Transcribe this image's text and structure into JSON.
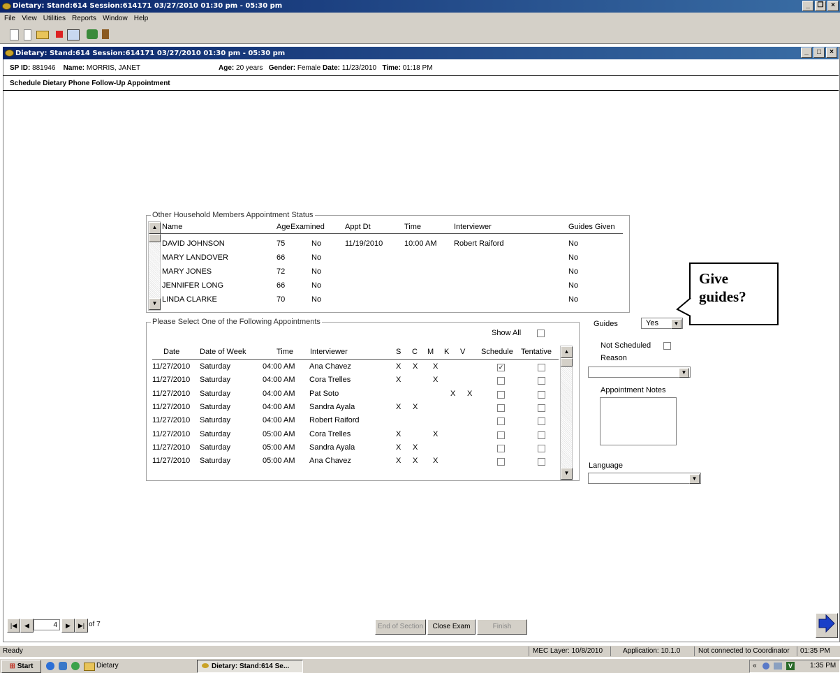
{
  "window": {
    "title": "Dietary: Stand:614 Session:614171 03/27/2010 01:30 pm - 05:30 pm"
  },
  "menu": [
    "File",
    "View",
    "Utilities",
    "Reports",
    "Window",
    "Help"
  ],
  "inner_window": {
    "title": "Dietary: Stand:614 Session:614171 03/27/2010 01:30 pm - 05:30 pm"
  },
  "participant": {
    "sp_id_label": "SP ID:",
    "sp_id": "881946",
    "name_label": "Name:",
    "name": "MORRIS, JANET",
    "age_label": "Age:",
    "age": "20 years",
    "gender_label": "Gender:",
    "gender": "Female",
    "date_label": "Date:",
    "date": "11/23/2010",
    "time_label": "Time:",
    "time": "01:18 PM"
  },
  "section_title": "Schedule Dietary Phone Follow-Up Appointment",
  "household": {
    "legend": "Other Household Members Appointment Status",
    "headers": [
      "Name",
      "Age",
      "Examined",
      "Appt Dt",
      "Time",
      "Interviewer",
      "Guides Given"
    ],
    "rows": [
      [
        "DAVID JOHNSON",
        "75",
        "No",
        "11/19/2010",
        "10:00 AM",
        "Robert Raiford",
        "No"
      ],
      [
        "MARY LANDOVER",
        "66",
        "No",
        "",
        "",
        "",
        "No"
      ],
      [
        "MARY JONES",
        "72",
        "No",
        "",
        "",
        "",
        "No"
      ],
      [
        "JENNIFER LONG",
        "66",
        "No",
        "",
        "",
        "",
        "No"
      ],
      [
        "LINDA CLARKE",
        "70",
        "No",
        "",
        "",
        "",
        "No"
      ]
    ]
  },
  "appointments": {
    "legend": "Please Select One of the Following Appointments",
    "show_all_label": "Show All",
    "headers": [
      "Date",
      "Date of Week",
      "Time",
      "Interviewer",
      "S",
      "C",
      "M",
      "K",
      "V",
      "Schedule",
      "Tentative"
    ],
    "rows": [
      {
        "date": "11/27/2010",
        "day": "Saturday",
        "time": "04:00 AM",
        "interviewer": "Ana Chavez",
        "s": "X",
        "c": "X",
        "m": "X",
        "k": "",
        "v": "",
        "schedule": true,
        "tentative": false
      },
      {
        "date": "11/27/2010",
        "day": "Saturday",
        "time": "04:00 AM",
        "interviewer": "Cora Trelles",
        "s": "X",
        "c": "",
        "m": "X",
        "k": "",
        "v": "",
        "schedule": false,
        "tentative": false
      },
      {
        "date": "11/27/2010",
        "day": "Saturday",
        "time": "04:00 AM",
        "interviewer": "Pat Soto",
        "s": "",
        "c": "",
        "m": "",
        "k": "X",
        "v": "X",
        "schedule": false,
        "tentative": false
      },
      {
        "date": "11/27/2010",
        "day": "Saturday",
        "time": "04:00 AM",
        "interviewer": "Sandra Ayala",
        "s": "X",
        "c": "X",
        "m": "",
        "k": "",
        "v": "",
        "schedule": false,
        "tentative": false
      },
      {
        "date": "11/27/2010",
        "day": "Saturday",
        "time": "04:00 AM",
        "interviewer": "Robert Raiford",
        "s": "",
        "c": "",
        "m": "",
        "k": "",
        "v": "",
        "schedule": false,
        "tentative": false
      },
      {
        "date": "11/27/2010",
        "day": "Saturday",
        "time": "05:00 AM",
        "interviewer": "Cora Trelles",
        "s": "X",
        "c": "",
        "m": "X",
        "k": "",
        "v": "",
        "schedule": false,
        "tentative": false
      },
      {
        "date": "11/27/2010",
        "day": "Saturday",
        "time": "05:00 AM",
        "interviewer": "Sandra Ayala",
        "s": "X",
        "c": "X",
        "m": "",
        "k": "",
        "v": "",
        "schedule": false,
        "tentative": false
      },
      {
        "date": "11/27/2010",
        "day": "Saturday",
        "time": "05:00 AM",
        "interviewer": "Ana Chavez",
        "s": "X",
        "c": "X",
        "m": "X",
        "k": "",
        "v": "",
        "schedule": false,
        "tentative": false
      }
    ]
  },
  "side": {
    "guides_label": "Guides",
    "guides_value": "Yes",
    "not_scheduled_label": "Not Scheduled",
    "reason_label": "Reason",
    "notes_label": "Appointment Notes",
    "language_label": "Language"
  },
  "callout": {
    "line1": "Give",
    "line2": "guides?"
  },
  "nav": {
    "page": "4",
    "of_label": "of 7"
  },
  "buttons": {
    "end_section": "End of Section",
    "close_exam": "Close Exam",
    "finish": "Finish"
  },
  "status": {
    "ready": "Ready",
    "mec_layer": "MEC Layer: 10/8/2010",
    "application": "Application: 10.1.0",
    "coordinator": "Not connected to Coordinator",
    "time": "01:35 PM"
  },
  "taskbar": {
    "start": "Start",
    "folder": "Dietary",
    "task": "Dietary: Stand:614 Se...",
    "clock": "1:35 PM"
  }
}
